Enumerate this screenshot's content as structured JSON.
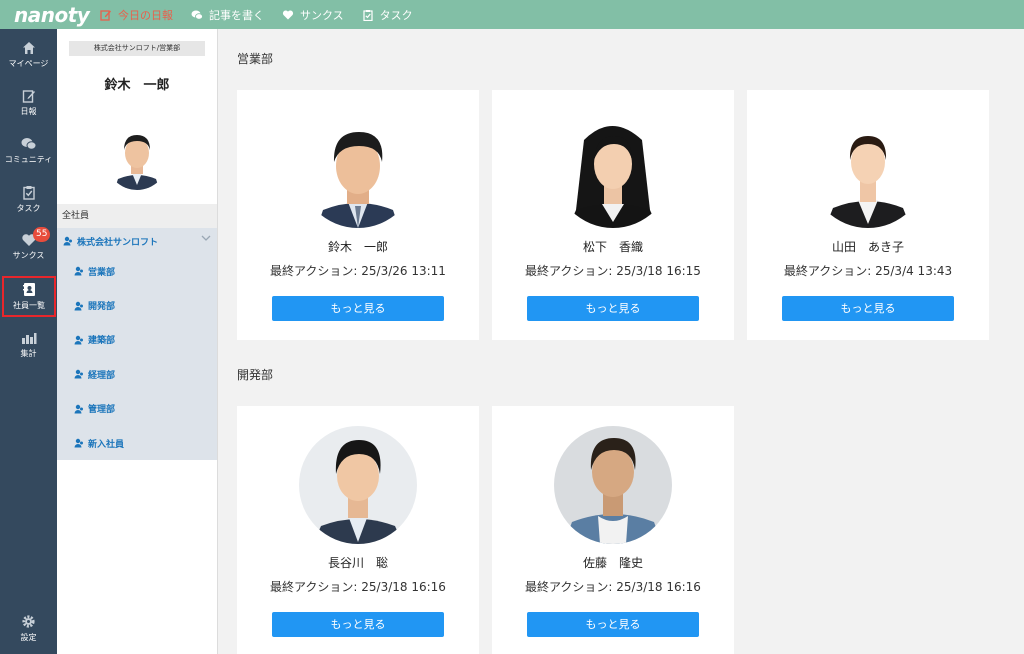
{
  "header": {
    "logo": "nanoty",
    "nav": [
      {
        "label": "今日の日報",
        "icon": "edit-icon",
        "active": true
      },
      {
        "label": "記事を書く",
        "icon": "chat-bubbles-icon"
      },
      {
        "label": "サンクス",
        "icon": "heart-icon"
      },
      {
        "label": "タスク",
        "icon": "clipboard-check-icon"
      }
    ]
  },
  "sidebar": {
    "items": [
      {
        "label": "マイページ",
        "icon": "home-icon"
      },
      {
        "label": "日報",
        "icon": "edit-icon"
      },
      {
        "label": "コミュニティ",
        "icon": "chat-bubbles-icon"
      },
      {
        "label": "タスク",
        "icon": "clipboard-check-icon"
      },
      {
        "label": "サンクス",
        "icon": "heart-icon",
        "badge": "55"
      },
      {
        "label": "社員一覧",
        "icon": "contact-book-icon",
        "selected": true
      },
      {
        "label": "集計",
        "icon": "bar-chart-icon"
      },
      {
        "label": "設定",
        "icon": "gear-icon"
      }
    ]
  },
  "user_panel": {
    "company_dept": "株式会社サンロフト/営業部",
    "name": "鈴木　一郎",
    "all_staff": "全社員",
    "company": "株式会社サンロフト",
    "departments": [
      "営業部",
      "開発部",
      "建築部",
      "経理部",
      "管理部",
      "新入社員"
    ]
  },
  "sections": [
    {
      "title": "営業部",
      "members": [
        {
          "name": "鈴木　一郎",
          "last_action": "最終アクション: 25/3/26 13:11",
          "button": "もっと見る"
        },
        {
          "name": "松下　香織",
          "last_action": "最終アクション: 25/3/18 16:15",
          "button": "もっと見る"
        },
        {
          "name": "山田　あき子",
          "last_action": "最終アクション: 25/3/4 13:43",
          "button": "もっと見る"
        }
      ]
    },
    {
      "title": "開発部",
      "members": [
        {
          "name": "長谷川　聡",
          "last_action": "最終アクション: 25/3/18 16:16",
          "button": "もっと見る"
        },
        {
          "name": "佐藤　隆史",
          "last_action": "最終アクション: 25/3/18 16:16",
          "button": "もっと見る"
        }
      ]
    }
  ],
  "colors": {
    "topbar": "#82bfa6",
    "sidebar": "#34495e",
    "accent_blue": "#2196f3",
    "active_red": "#e8604c",
    "badge_red": "#e74c3c"
  }
}
